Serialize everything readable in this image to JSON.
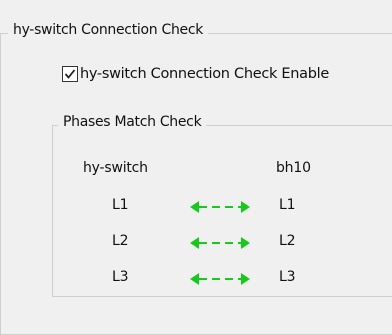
{
  "connection_group": {
    "title": "hy-switch Connection Check",
    "enable_label": "hy-switch Connection Check Enable",
    "enable_checked": true
  },
  "phases_group": {
    "title": "Phases Match Check",
    "left_header": "hy-switch",
    "right_header": "bh10",
    "rows": [
      {
        "left": "L1",
        "right": "L1"
      },
      {
        "left": "L2",
        "right": "L2"
      },
      {
        "left": "L3",
        "right": "L3"
      }
    ]
  },
  "colors": {
    "arrow_green": "#18c91d"
  },
  "icons": {
    "match_arrow": "double-headed-arrow-icon",
    "checkmark": "checkmark-icon"
  }
}
